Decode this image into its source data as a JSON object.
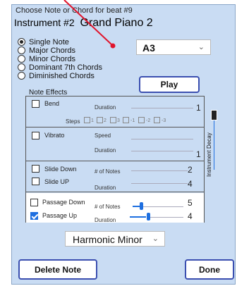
{
  "header": {
    "choose_prompt": "Choose Note or Chord for beat #9",
    "instrument_label": "Instrument #2",
    "instrument_name": "Grand Piano 2"
  },
  "modes": [
    {
      "label": "Single Note",
      "selected": true
    },
    {
      "label": "Major Chords",
      "selected": false
    },
    {
      "label": "Minor Chords",
      "selected": false
    },
    {
      "label": "Dominant 7th Chords",
      "selected": false
    },
    {
      "label": "Diminished Chords",
      "selected": false
    }
  ],
  "note_select": {
    "value": "A3"
  },
  "buttons": {
    "play": "Play",
    "delete": "Delete Note",
    "done": "Done"
  },
  "effects": {
    "title": "Note Effects",
    "bend": {
      "label": "Bend",
      "checked": false,
      "duration_label": "Duration",
      "duration_value": "1",
      "steps_label": "Steps",
      "steps": [
        "1",
        "2",
        "3",
        "-1",
        "-2",
        "-3"
      ]
    },
    "vibrato": {
      "label": "Vibrato",
      "checked": false,
      "speed_label": "Speed",
      "duration_label": "Duration",
      "duration_value": "1"
    },
    "slide_down": {
      "label": "Slide Down",
      "checked": false,
      "notes_label": "# of Notes",
      "notes_value": "2"
    },
    "slide_up": {
      "label": "Slide UP",
      "checked": false,
      "duration_label": "Duration",
      "duration_value": "4"
    },
    "passage_down": {
      "label": "Passage Down",
      "checked": false,
      "notes_label": "# of Notes",
      "notes_value": "5"
    },
    "passage_up": {
      "label": "Passage Up",
      "checked": true,
      "duration_label": "Duration",
      "duration_value": "4"
    },
    "scale": {
      "value": "Harmonic Minor"
    },
    "decay_label": "Instrument Decay"
  },
  "colors": {
    "dialog_bg": "#c9dcf3",
    "accent": "#1e6fe0",
    "arrow": "#e0142b"
  }
}
